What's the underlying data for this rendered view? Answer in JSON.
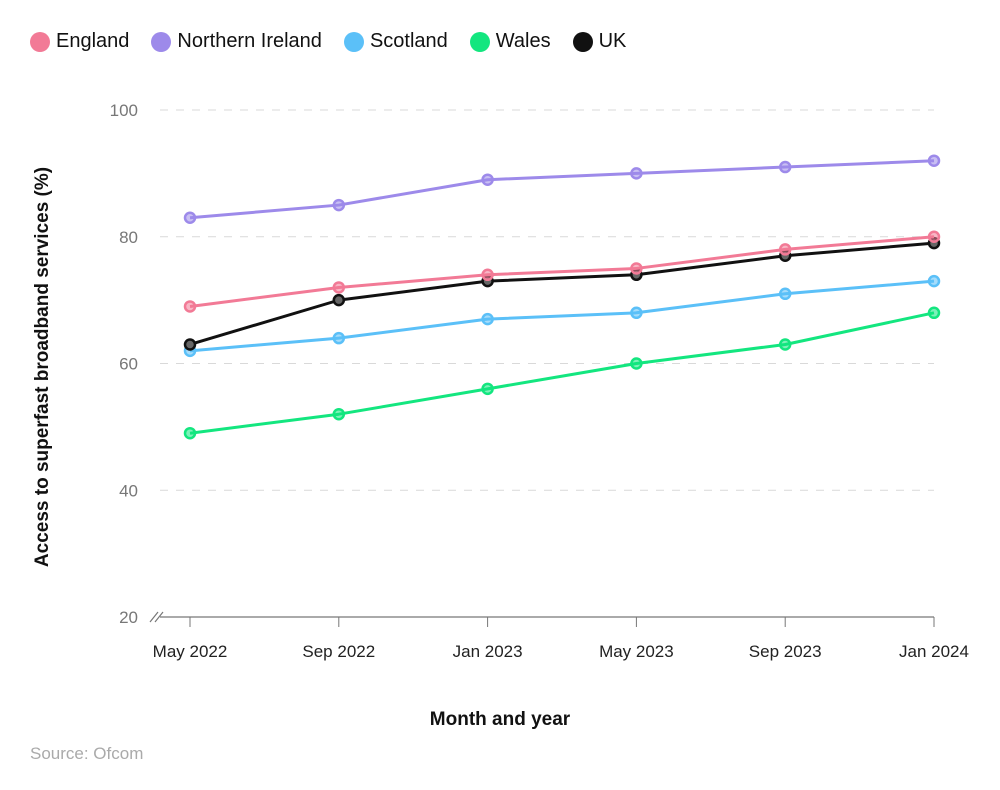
{
  "chart_data": {
    "type": "line",
    "title": "",
    "xlabel": "Month and year",
    "ylabel": "Access to superfast broadband services (%)",
    "ylim": [
      20,
      100
    ],
    "yticks": [
      20,
      40,
      60,
      80,
      100
    ],
    "y_axis_break": true,
    "grid": true,
    "legend_position": "top-left",
    "categories": [
      "May 2022",
      "Sep 2022",
      "Jan 2023",
      "May 2023",
      "Sep 2023",
      "Jan 2024"
    ],
    "series": [
      {
        "name": "England",
        "color": "#f27a96",
        "values": [
          69,
          72,
          74,
          75,
          78,
          80
        ]
      },
      {
        "name": "Northern Ireland",
        "color": "#9d8aea",
        "values": [
          83,
          85,
          89,
          90,
          91,
          92
        ]
      },
      {
        "name": "Scotland",
        "color": "#5bc0f8",
        "values": [
          62,
          64,
          67,
          68,
          71,
          73
        ]
      },
      {
        "name": "Wales",
        "color": "#13e67f",
        "values": [
          49,
          52,
          56,
          60,
          63,
          68
        ]
      },
      {
        "name": "UK",
        "color": "#111111",
        "values": [
          63,
          70,
          73,
          74,
          77,
          79
        ]
      }
    ]
  },
  "source": "Source: Ofcom"
}
